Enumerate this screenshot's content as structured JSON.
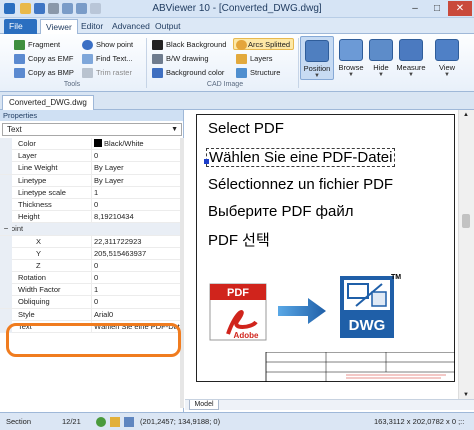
{
  "window": {
    "title": "ABViewer 10 - [Converted_DWG.dwg]",
    "controls": {
      "minimize": "–",
      "maximize": "□",
      "close": "✕"
    }
  },
  "tabs": [
    {
      "label": "File"
    },
    {
      "label": "Viewer"
    },
    {
      "label": "Editor"
    },
    {
      "label": "Advanced"
    },
    {
      "label": "Output"
    }
  ],
  "ribbon": {
    "tools": {
      "label": "Tools",
      "items": [
        {
          "label": "Fragment",
          "icon": "fragment-icon"
        },
        {
          "label": "Show point",
          "icon": "show-point-icon"
        },
        {
          "label": "Copy as EMF",
          "icon": "copy-emf-icon"
        },
        {
          "label": "Find Text...",
          "icon": "find-text-icon"
        },
        {
          "label": "Copy as BMP",
          "icon": "copy-bmp-icon"
        },
        {
          "label": "Trim raster",
          "icon": "trim-raster-icon"
        }
      ]
    },
    "cad_image": {
      "label": "CAD Image",
      "items": [
        {
          "label": "Black Background",
          "icon": "black-background-icon"
        },
        {
          "label": "Arcs Splitted",
          "icon": "arcs-splitted-icon"
        },
        {
          "label": "B/W drawing",
          "icon": "bw-drawing-icon"
        },
        {
          "label": "Layers",
          "icon": "layers-icon"
        },
        {
          "label": "Background color",
          "icon": "background-color-icon"
        },
        {
          "label": "Structure",
          "icon": "structure-icon"
        }
      ]
    },
    "big_buttons": [
      {
        "label": "Position"
      },
      {
        "label": "Browse"
      },
      {
        "label": "Hide"
      },
      {
        "label": "Measure"
      },
      {
        "label": "View"
      }
    ]
  },
  "document_tab": "Converted_DWG.dwg",
  "properties": {
    "header": "Properties",
    "object_type": "Text",
    "rows": [
      {
        "key": "Color",
        "value": "Black/White"
      },
      {
        "key": "Layer",
        "value": "0"
      },
      {
        "key": "Line Weight",
        "value": "By Layer"
      },
      {
        "key": "Linetype",
        "value": "By Layer"
      },
      {
        "key": "Linetype scale",
        "value": "1"
      },
      {
        "key": "Thickness",
        "value": "0"
      },
      {
        "key": "Height",
        "value": "8,19210434"
      },
      {
        "key": "Point",
        "value": ""
      },
      {
        "key": "X",
        "value": "22,311722923"
      },
      {
        "key": "Y",
        "value": "205,515463937"
      },
      {
        "key": "Z",
        "value": "0"
      },
      {
        "key": "Rotation",
        "value": "0"
      },
      {
        "key": "Width Factor",
        "value": "1"
      },
      {
        "key": "Obliquing",
        "value": "0"
      },
      {
        "key": "Style",
        "value": "Arial0"
      },
      {
        "key": "Text",
        "value": "Wählen Sie eine PDF-Datei"
      }
    ]
  },
  "drawing": {
    "lines": [
      "Select PDF",
      "Wählen Sie eine PDF-Datei",
      "Sélectionnez un fichier PDF",
      "Выберите PDF файл",
      "PDF 선택"
    ],
    "pdf_logo": {
      "top": "PDF",
      "bottom": "Adobe"
    },
    "dwg_logo": {
      "label": "DWG",
      "tm": "TM"
    },
    "model_tab": "Model"
  },
  "status": {
    "section": "Section",
    "page": "12/21",
    "coords": "(201,2457; 134,9188; 0)",
    "size": "163,3112 x 202,0782 x 0 ;::"
  },
  "colors": {
    "accent": "#2b6fc0",
    "highlight": "#f07c1f",
    "dwg_blue": "#1f5fa8",
    "pdf_red": "#d0241c"
  }
}
